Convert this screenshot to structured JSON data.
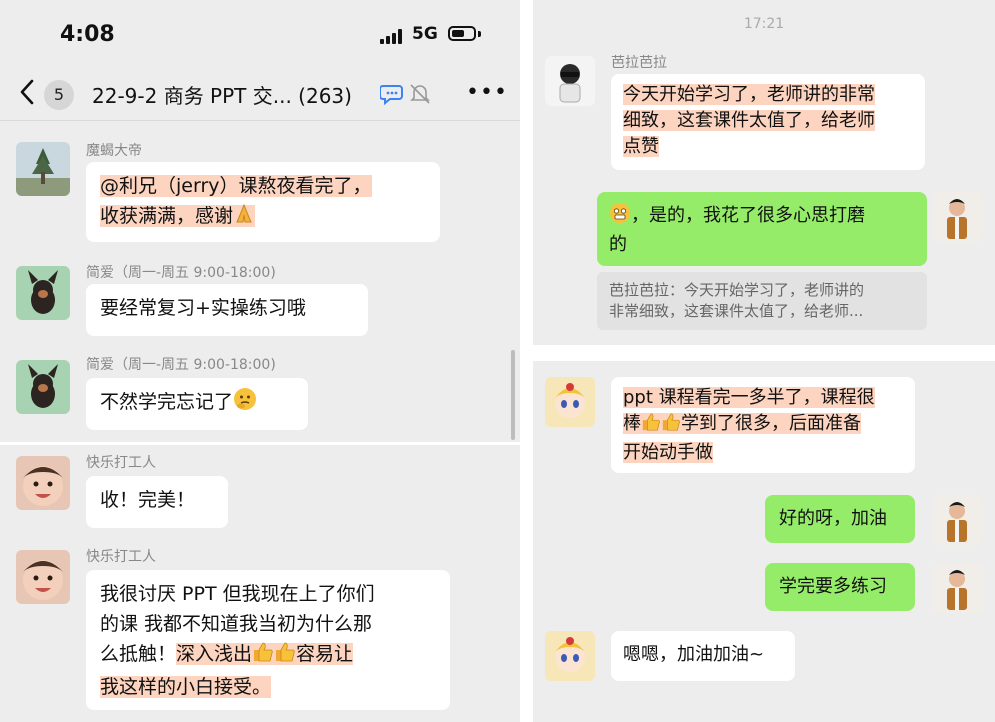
{
  "status": {
    "time": "4:08",
    "network": "5G"
  },
  "chat": {
    "badge": "5",
    "title": "22-9-2 商务 PPT 交... (263)"
  },
  "left_messages": [
    {
      "name": "魔蝎大帝",
      "line1": "@利兄（jerry）课熬夜看完了，",
      "line2": "收获满满，感谢"
    },
    {
      "name": "简爱（周一-周五 9:00-18:00)",
      "text": "要经常复习+实操练习哦"
    },
    {
      "name": "简爱（周一-周五 9:00-18:00)",
      "text": "不然学完忘记了"
    },
    {
      "name": "快乐打工人",
      "text": "收！完美！"
    },
    {
      "name": "快乐打工人",
      "line1": "我很讨厌 PPT 但我现在上了你们",
      "line2": "的课 我都不知道我当初为什么那",
      "line3a": "么抵触！",
      "line3b": "深入浅出",
      "line3c": "容易让",
      "line4": "我这样的小白接受。"
    }
  ],
  "right_top": {
    "time": "17:21",
    "sender": "芭拉芭拉",
    "msg_line1": "今天开始学习了，老师讲的非常",
    "msg_line2": "细致，这套课件太值了，给老师",
    "msg_line3": "点赞",
    "reply_line1": "，是的，我花了很多心思打磨",
    "reply_line2": "的",
    "quote_line1": "芭拉芭拉：今天开始学习了，老师讲的",
    "quote_line2": "非常细致，这套课件太值了，给老师..."
  },
  "right_bottom": {
    "msg_line1": "ppt 课程看完一多半了，课程很",
    "msg_line2a": "棒",
    "msg_line2b": "学到了很多，后面准备",
    "msg_line3": "开始动手做",
    "reply1": "好的呀，加油",
    "reply2": "学完要多练习",
    "msg2": "嗯嗯，加油加油~"
  },
  "icons": [
    "back-chevron-icon",
    "chat-bubble-icon",
    "mute-bell-icon",
    "more-dots-icon",
    "praying-hands-icon",
    "thinking-face-icon",
    "thumbs-up-icon",
    "grimace-face-icon"
  ],
  "colors": {
    "background": "#ededed",
    "own_bubble": "#95ec69",
    "highlight": "#fcd4c0"
  }
}
